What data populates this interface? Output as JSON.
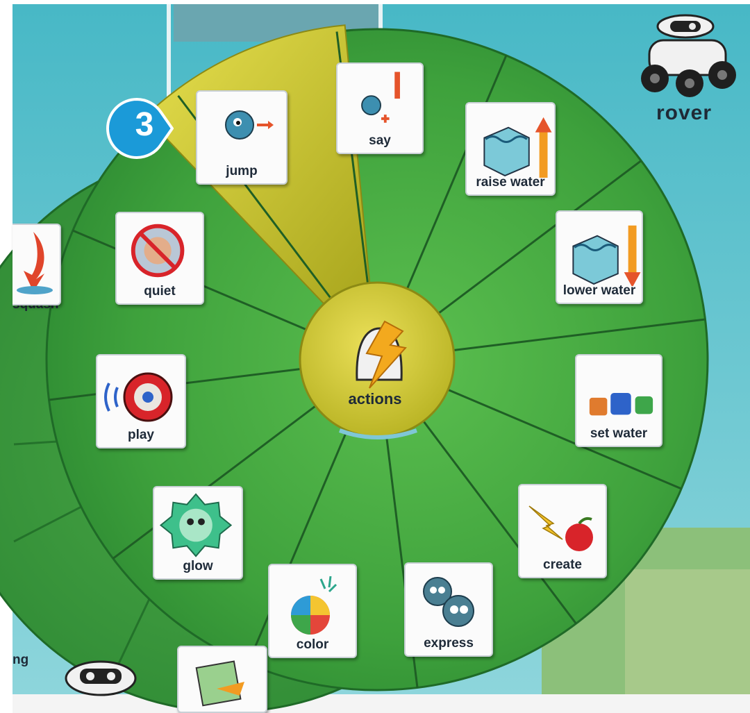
{
  "menu": {
    "center_label": "actions",
    "step_badge": "3",
    "items": [
      {
        "label": "jump",
        "icon": "jump-kodu-icon",
        "selected": true
      },
      {
        "label": "say",
        "icon": "say-icon",
        "selected": false
      },
      {
        "label": "raise water",
        "icon": "raise-water-icon",
        "selected": false
      },
      {
        "label": "lower water",
        "icon": "lower-water-icon",
        "selected": false
      },
      {
        "label": "set water",
        "icon": "set-water-icon",
        "selected": false
      },
      {
        "label": "create",
        "icon": "create-icon",
        "selected": false
      },
      {
        "label": "express",
        "icon": "express-icon",
        "selected": false
      },
      {
        "label": "color",
        "icon": "color-icon",
        "selected": false
      },
      {
        "label": "glow",
        "icon": "glow-icon",
        "selected": false
      },
      {
        "label": "play",
        "icon": "play-sound-icon",
        "selected": false
      },
      {
        "label": "quiet",
        "icon": "quiet-icon",
        "selected": false
      }
    ]
  },
  "back_menu": {
    "partial_labels": [
      "squash",
      "ng"
    ]
  },
  "character": {
    "name": "rover",
    "icon": "rover-robot-icon"
  },
  "colors": {
    "wheel_green": "#3fa33f",
    "wheel_green_dark": "#257a2a",
    "selected_yellow": "#d4cc2e",
    "badge_blue": "#1b9ad8",
    "sky": "#5fc4d0"
  }
}
